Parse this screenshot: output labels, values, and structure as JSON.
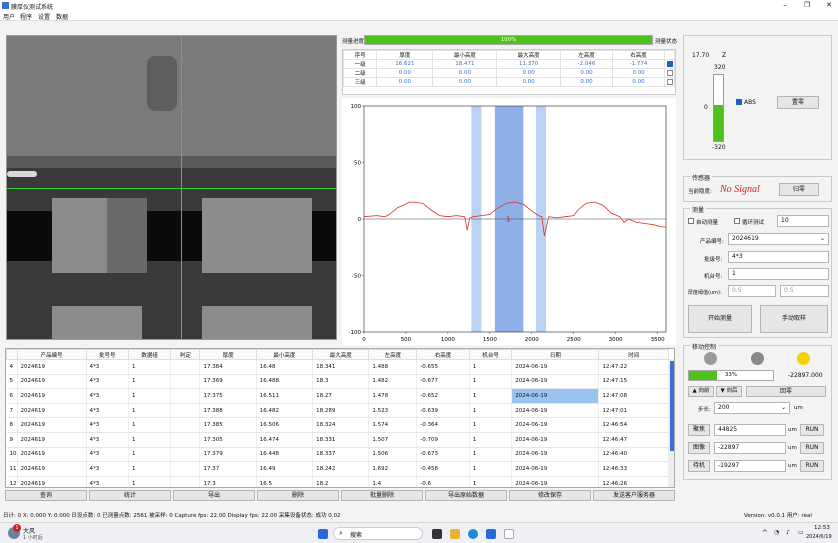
{
  "app": {
    "title": "膜厚仪测试系统",
    "menu": [
      "用户",
      "程序",
      "设置",
      "数据"
    ]
  },
  "measure": {
    "progress_label": "测量进度",
    "progress_pct": 100,
    "progress_text": "100%",
    "state_label": "测量状态"
  },
  "mini_table": {
    "headers": [
      "序号",
      "厚度",
      "最小高度",
      "最大高度",
      "左高度",
      "右高度"
    ],
    "rows": [
      [
        "一级",
        "16.621",
        "18.471",
        "11.370",
        "-2.046",
        "-1.774"
      ],
      [
        "二级",
        "0.00",
        "0.00",
        "0.00",
        "0.00",
        "0.00"
      ],
      [
        "三级",
        "0.00",
        "0.00",
        "0.00",
        "0.00",
        "0.00"
      ]
    ],
    "checked": [
      true,
      false,
      false
    ]
  },
  "chart_data": {
    "type": "line",
    "x_ticks": [
      "0",
      "500",
      "1000",
      "1500",
      "2000",
      "2500",
      "3000",
      "3500"
    ],
    "y_ticks": [
      "100",
      "50",
      "0",
      "-50",
      "-100"
    ],
    "xlim": [
      0,
      3600
    ],
    "ylim": [
      -100,
      100
    ],
    "marker_label": "1",
    "bands": [
      {
        "x0": 1280,
        "x1": 1400,
        "color": "#b8d4f2"
      },
      {
        "x0": 1560,
        "x1": 1900,
        "color": "#8eb0e6"
      },
      {
        "x0": 2050,
        "x1": 2170,
        "color": "#b8d4f2"
      }
    ],
    "series": [
      {
        "color": "#d9302a",
        "points": [
          [
            0,
            2
          ],
          [
            150,
            3
          ],
          [
            250,
            2
          ],
          [
            300,
            4
          ],
          [
            400,
            10
          ],
          [
            550,
            15
          ],
          [
            700,
            14
          ],
          [
            800,
            8
          ],
          [
            900,
            3
          ],
          [
            1000,
            2
          ],
          [
            1100,
            3
          ],
          [
            1200,
            2
          ],
          [
            1230,
            -10
          ],
          [
            1260,
            1
          ],
          [
            1300,
            2
          ],
          [
            1400,
            3
          ],
          [
            1500,
            4
          ],
          [
            1580,
            9
          ],
          [
            1700,
            14
          ],
          [
            1800,
            15
          ],
          [
            1900,
            13
          ],
          [
            2000,
            7
          ],
          [
            2080,
            3
          ],
          [
            2120,
            2
          ],
          [
            2150,
            -15
          ],
          [
            2200,
            2
          ],
          [
            2300,
            1
          ],
          [
            2400,
            2
          ],
          [
            2500,
            3
          ],
          [
            2550,
            8
          ],
          [
            2650,
            14
          ],
          [
            2750,
            15
          ],
          [
            2850,
            12
          ],
          [
            2950,
            5
          ],
          [
            3050,
            2
          ],
          [
            3100,
            -3
          ],
          [
            3150,
            0
          ],
          [
            3250,
            -3
          ],
          [
            3350,
            -4
          ],
          [
            3450,
            -5
          ],
          [
            3550,
            -7
          ],
          [
            3600,
            -7
          ]
        ]
      }
    ]
  },
  "zaxis": {
    "top_left": "17.70",
    "label": "Z",
    "max": "320",
    "min": "-320",
    "value": "0",
    "abs_label": "ABS",
    "zero_btn": "置零",
    "fill_fraction": 0.55
  },
  "sensor": {
    "group": "传感器",
    "label": "当前隐度:",
    "status": "No Signal",
    "reset": "归零"
  },
  "measure_grp": {
    "group": "测量",
    "auto": "自动测量",
    "loop": "循环测试",
    "count": "10",
    "product_no_label": "产品编号:",
    "product_no": "2024619",
    "batch_label": "批级号:",
    "batch": "4*3",
    "machine_label": "机台号:",
    "machine": "1",
    "range_label": "厚度阈值(um):",
    "range_min": "0.5",
    "range_max": "0.5",
    "start_btn": "开始测量",
    "manual_btn": "手动取样"
  },
  "motor": {
    "group": "移动控制",
    "light_colors": [
      "#9a9a9a",
      "#8a8a8a",
      "#f2d400"
    ],
    "pct_text": "33%",
    "pct": 0.33,
    "value": "-22897.000",
    "up_btn": "▲ 向前",
    "down_btn": "▼ 向后",
    "zero_btn": "回零",
    "step_label": "步长:",
    "step": "200",
    "unit": "um",
    "rows": [
      {
        "label": "聚焦",
        "value": "44825",
        "unit": "um",
        "btn": "RUN"
      },
      {
        "label": "图像",
        "value": "-22897",
        "unit": "um",
        "btn": "RUN"
      },
      {
        "label": "待机",
        "value": "-19297",
        "unit": "um",
        "btn": "RUN"
      }
    ]
  },
  "data_table": {
    "headers": [
      "",
      "产品编号",
      "批号号",
      "数据组",
      "判定",
      "厚度",
      "最小高度",
      "最大高度",
      "左高度",
      "右高度",
      "机台号",
      "日期",
      "时间"
    ],
    "rows": [
      [
        "4",
        "2024619",
        "4*3",
        "1",
        "",
        "17.384",
        "16.48",
        "18.341",
        "1.488",
        "-0.655",
        "1",
        "2024-06-19",
        "12:47:22"
      ],
      [
        "5",
        "2024619",
        "4*3",
        "1",
        "",
        "17.369",
        "16.488",
        "18.3",
        "1.482",
        "-0.677",
        "1",
        "2024-06-19",
        "12:47:15"
      ],
      [
        "6",
        "2024619",
        "4*3",
        "1",
        "",
        "17.375",
        "16.511",
        "18.27",
        "1.478",
        "-0.652",
        "1",
        "2024-06-19",
        "12:47:08"
      ],
      [
        "7",
        "2024619",
        "4*3",
        "1",
        "",
        "17.388",
        "16.482",
        "18.289",
        "1.523",
        "-0.639",
        "1",
        "2024-06-19",
        "12:47:01"
      ],
      [
        "8",
        "2024619",
        "4*3",
        "1",
        "",
        "17.385",
        "16.506",
        "18.324",
        "1.574",
        "-0.364",
        "1",
        "2024-06-19",
        "12:46:54"
      ],
      [
        "9",
        "2024619",
        "4*3",
        "1",
        "",
        "17.305",
        "16.474",
        "18.331",
        "1.507",
        "-0.709",
        "1",
        "2024-06-19",
        "12:46:47"
      ],
      [
        "10",
        "2024619",
        "4*3",
        "1",
        "",
        "17.379",
        "16.448",
        "18.337",
        "1.506",
        "-0.673",
        "1",
        "2024-06-19",
        "12:46:40"
      ],
      [
        "11",
        "2024619",
        "4*3",
        "1",
        "",
        "17.37",
        "16.49",
        "18.242",
        "1.692",
        "-0.458",
        "1",
        "2024-06-19",
        "12:46:33"
      ],
      [
        "12",
        "2024619",
        "4*3",
        "1",
        "",
        "17.3",
        "16.5",
        "18.2",
        "1.4",
        "-0.6",
        "1",
        "2024-06-19",
        "12:46:26"
      ]
    ],
    "selected_row": 2,
    "selected_col": 11
  },
  "bottom_buttons": [
    "查询",
    "统计",
    "导出",
    "删除",
    "批量删除",
    "导出原始数据",
    "修改保存",
    "发送客户服务器"
  ],
  "status": {
    "left": "日计: 0  X: 0.000  Y: 0.000  日设点数: 0  已测量点数: 2561  被采样: 0  Capture fps: 22.00  Display fps: 22.00  采集设备状态: 成功  0.02",
    "right": "Version: v0.0.1  用户: real"
  },
  "taskbar": {
    "weather_title": "大风",
    "weather_sub": "1 小时后",
    "search": "搜索",
    "time": "12:53",
    "date": "2024/6/19",
    "badge": "1"
  }
}
